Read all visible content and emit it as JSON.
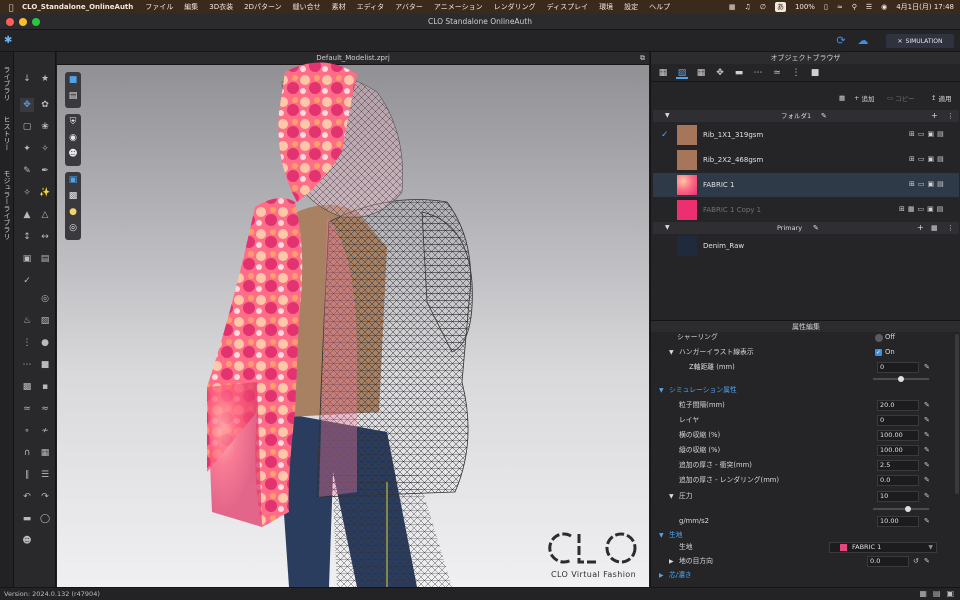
{
  "menubar": {
    "app_name": "CLO_Standalone_OnlineAuth",
    "menus": [
      "ファイル",
      "編集",
      "3D衣装",
      "2Dパターン",
      "縫い合せ",
      "素材",
      "エディタ",
      "アバター",
      "アニメーション",
      "レンダリング",
      "ディスプレイ",
      "環境",
      "設定",
      "ヘルプ"
    ],
    "battery": "100%",
    "date_time": "4月1日(月) 17:48",
    "input_badge": "あ"
  },
  "window": {
    "title": "CLO Standalone OnlineAuth"
  },
  "toolbar": {
    "simulation_label": "SIMULATION"
  },
  "left_tabs": [
    "ライブラリ",
    "ヒストリー",
    "モジュラーライブラリ"
  ],
  "viewport": {
    "file_name": "Default_Modelist.zprj",
    "brand_text": "CLO",
    "brand_sub": "CLO Virtual Fashion"
  },
  "object_browser": {
    "title": "オブジェクトブラウザ",
    "actions": {
      "add": "追加",
      "copy": "コピー",
      "apply": "適用"
    },
    "folder": "フォルダ1",
    "fabrics": [
      {
        "name": "Rib_1X1_319gsm",
        "color": "#a7765a",
        "checked": true
      },
      {
        "name": "Rib_2X2_468gsm",
        "color": "#a7765a",
        "checked": false
      },
      {
        "name": "FABRIC 1",
        "color": "#f05a82",
        "checked": false,
        "selected": true
      },
      {
        "name": "FABRIC 1 Copy 1",
        "color": "#ee2f6f",
        "checked": false,
        "dimmed": true
      }
    ],
    "primary_group": "Primary",
    "denim": {
      "name": "Denim_Raw",
      "color": "#1f2a3d"
    }
  },
  "property_editor": {
    "title": "属性編集",
    "shirring": {
      "label": "シャーリング",
      "state": "Off"
    },
    "hanger_illust": {
      "label": "ハンガーイラスト線表示",
      "state": "On"
    },
    "z_offset": {
      "label": "Z軸距離 (mm)",
      "value": "0",
      "slider": 0.5
    },
    "simulation_section": "シミュレーション属性",
    "particle_distance": {
      "label": "粒子間隔(mm)",
      "value": "20.0"
    },
    "layer": {
      "label": "レイヤ",
      "value": "0"
    },
    "shrink_weft": {
      "label": "横の収縮 (%)",
      "value": "100.00"
    },
    "shrink_warp": {
      "label": "縦の収縮 (%)",
      "value": "100.00"
    },
    "add_thickness_collision": {
      "label": "追加の厚さ - 衝突(mm)",
      "value": "2.5"
    },
    "add_thickness_render": {
      "label": "追加の厚さ - レンダリング(mm)",
      "value": "0.0"
    },
    "pressure": {
      "label": "圧力",
      "value": "10",
      "slider": 0.6
    },
    "pressure_unit": {
      "label": "g/mm/s2",
      "value": "10.00"
    },
    "fabric_section": "生地",
    "fabric": {
      "label": "生地",
      "value": "FABRIC 1"
    },
    "grain_direction": {
      "label": "地の目方向",
      "value": "0.0"
    },
    "interlining_section": "芯/濃き"
  },
  "status": {
    "version": "Version: 2024.0.132 (r47904)"
  }
}
